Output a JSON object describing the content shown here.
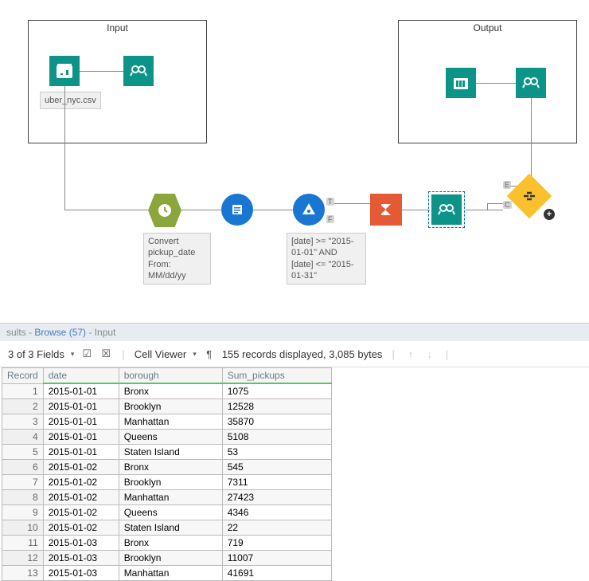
{
  "containers": {
    "input": {
      "title": "Input",
      "file_label": "uber_nyc.csv"
    },
    "output": {
      "title": "Output"
    }
  },
  "annotations": {
    "convert": "Convert pickup_date From: MM/dd/yy",
    "filter": "[date] >= \"2015-01-01\" AND [date] <= \"2015-01-31\""
  },
  "ports": {
    "t": "T",
    "f": "F",
    "e": "E",
    "c": "C"
  },
  "results": {
    "header_prefix": "sults - ",
    "browse": "Browse (57)",
    "input_suffix": " - Input",
    "field_count": "3 of 3 Fields",
    "viewer_label": "Cell Viewer",
    "record_info": "155 records displayed, 3,085 bytes"
  },
  "table": {
    "columns": [
      "Record",
      "date",
      "borough",
      "Sum_pickups"
    ],
    "rows": [
      [
        "1",
        "2015-01-01",
        "Bronx",
        "1075"
      ],
      [
        "2",
        "2015-01-01",
        "Brooklyn",
        "12528"
      ],
      [
        "3",
        "2015-01-01",
        "Manhattan",
        "35870"
      ],
      [
        "4",
        "2015-01-01",
        "Queens",
        "5108"
      ],
      [
        "5",
        "2015-01-01",
        "Staten Island",
        "53"
      ],
      [
        "6",
        "2015-01-02",
        "Bronx",
        "545"
      ],
      [
        "7",
        "2015-01-02",
        "Brooklyn",
        "7311"
      ],
      [
        "8",
        "2015-01-02",
        "Manhattan",
        "27423"
      ],
      [
        "9",
        "2015-01-02",
        "Queens",
        "4346"
      ],
      [
        "10",
        "2015-01-02",
        "Staten Island",
        "22"
      ],
      [
        "11",
        "2015-01-03",
        "Bronx",
        "719"
      ],
      [
        "12",
        "2015-01-03",
        "Brooklyn",
        "11007"
      ],
      [
        "13",
        "2015-01-03",
        "Manhattan",
        "41691"
      ]
    ]
  }
}
